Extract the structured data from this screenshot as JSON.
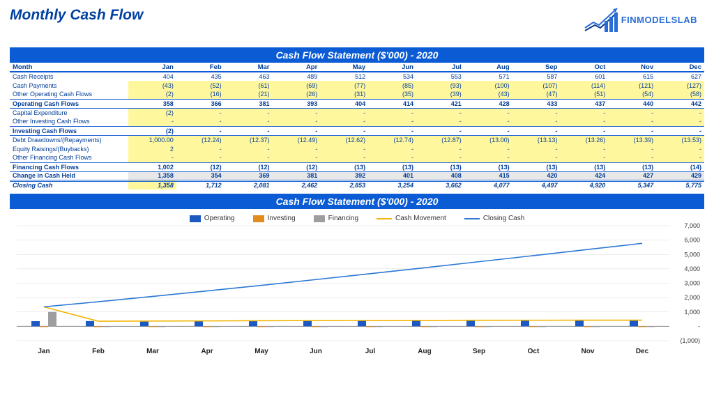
{
  "title": "Monthly Cash Flow",
  "logo_text": "FINMODELSLAB",
  "banner_table": "Cash Flow Statement ($'000) - 2020",
  "banner_chart": "Cash Flow Statement ($'000) - 2020",
  "header_label": "Month",
  "months": [
    "Jan",
    "Feb",
    "Mar",
    "Apr",
    "May",
    "Jun",
    "Jul",
    "Aug",
    "Sep",
    "Oct",
    "Nov",
    "Dec"
  ],
  "rows": {
    "cash_receipts": {
      "label": "Cash Receipts",
      "v": [
        "404",
        "435",
        "463",
        "489",
        "512",
        "534",
        "553",
        "571",
        "587",
        "601",
        "615",
        "627"
      ]
    },
    "cash_payments": {
      "label": "Cash Payments",
      "v": [
        "(43)",
        "(52)",
        "(61)",
        "(69)",
        "(77)",
        "(85)",
        "(93)",
        "(100)",
        "(107)",
        "(114)",
        "(121)",
        "(127)"
      ]
    },
    "other_operating": {
      "label": "Other Operating Cash Flows",
      "v": [
        "(2)",
        "(16)",
        "(21)",
        "(26)",
        "(31)",
        "(35)",
        "(39)",
        "(43)",
        "(47)",
        "(51)",
        "(54)",
        "(58)"
      ]
    },
    "operating_total": {
      "label": "Operating Cash Flows",
      "v": [
        "358",
        "366",
        "381",
        "393",
        "404",
        "414",
        "421",
        "428",
        "433",
        "437",
        "440",
        "442"
      ]
    },
    "capex": {
      "label": "Capital Expenditure",
      "v": [
        "(2)",
        "-",
        "-",
        "-",
        "-",
        "-",
        "-",
        "-",
        "-",
        "-",
        "-",
        "-"
      ]
    },
    "other_investing": {
      "label": "Other Investing Cash Flows",
      "v": [
        "-",
        "-",
        "-",
        "-",
        "-",
        "-",
        "-",
        "-",
        "-",
        "-",
        "-",
        "-"
      ]
    },
    "investing_total": {
      "label": "Investing Cash Flows",
      "v": [
        "(2)",
        "-",
        "-",
        "-",
        "-",
        "-",
        "-",
        "-",
        "-",
        "-",
        "-",
        "-"
      ]
    },
    "debt_drawdowns": {
      "label": "Debt Drawdowns/(Repayments)",
      "v": [
        "1,000.00",
        "(12.24)",
        "(12.37)",
        "(12.49)",
        "(12.62)",
        "(12.74)",
        "(12.87)",
        "(13.00)",
        "(13.13)",
        "(13.26)",
        "(13.39)",
        "(13.53)"
      ]
    },
    "equity_raisings": {
      "label": "Equity Raisings/(Buybacks)",
      "v": [
        "2",
        "-",
        "-",
        "-",
        "-",
        "-",
        "-",
        "-",
        "-",
        "-",
        "-",
        "-"
      ]
    },
    "other_financing": {
      "label": "Other Financing Cash Flows",
      "v": [
        "-",
        "-",
        "-",
        "-",
        "-",
        "-",
        "-",
        "-",
        "-",
        "-",
        "-",
        "-"
      ]
    },
    "financing_total": {
      "label": "Financing Cash Flows",
      "v": [
        "1,002",
        "(12)",
        "(12)",
        "(12)",
        "(13)",
        "(13)",
        "(13)",
        "(13)",
        "(13)",
        "(13)",
        "(13)",
        "(14)"
      ]
    },
    "change_cash": {
      "label": "Change in Cash Held",
      "v": [
        "1,358",
        "354",
        "369",
        "381",
        "392",
        "401",
        "408",
        "415",
        "420",
        "424",
        "427",
        "429"
      ]
    },
    "closing_cash": {
      "label": "Closing Cash",
      "v": [
        "1,358",
        "1,712",
        "2,081",
        "2,462",
        "2,853",
        "3,254",
        "3,662",
        "4,077",
        "4,497",
        "4,920",
        "5,347",
        "5,775"
      ]
    }
  },
  "chart_data": {
    "type": "bar+line",
    "categories": [
      "Jan",
      "Feb",
      "Mar",
      "Apr",
      "May",
      "Jun",
      "Jul",
      "Aug",
      "Sep",
      "Oct",
      "Nov",
      "Dec"
    ],
    "series": [
      {
        "name": "Operating",
        "type": "bar",
        "color": "#1b58c2",
        "values": [
          358,
          366,
          381,
          393,
          404,
          414,
          421,
          428,
          433,
          437,
          440,
          442
        ]
      },
      {
        "name": "Investing",
        "type": "bar",
        "color": "#e28c1d",
        "values": [
          -2,
          0,
          0,
          0,
          0,
          0,
          0,
          0,
          0,
          0,
          0,
          0
        ]
      },
      {
        "name": "Financing",
        "type": "bar",
        "color": "#9e9e9e",
        "values": [
          1002,
          -12,
          -12,
          -12,
          -13,
          -13,
          -13,
          -13,
          -13,
          -13,
          -13,
          -14
        ]
      },
      {
        "name": "Cash Movement",
        "type": "line",
        "color": "#f2b400",
        "values": [
          1358,
          354,
          369,
          381,
          392,
          401,
          408,
          415,
          420,
          424,
          427,
          429
        ]
      },
      {
        "name": "Closing Cash",
        "type": "line",
        "color": "#2a78d4",
        "values": [
          1358,
          1712,
          2081,
          2462,
          2853,
          3254,
          3662,
          4077,
          4497,
          4920,
          5347,
          5775
        ]
      }
    ],
    "ylim": [
      -1000,
      7000
    ],
    "yticks": [
      -1000,
      0,
      1000,
      2000,
      3000,
      4000,
      5000,
      6000,
      7000
    ],
    "ytick_labels": [
      "(1,000)",
      "-",
      "1,000",
      "2,000",
      "3,000",
      "4,000",
      "5,000",
      "6,000",
      "7,000"
    ]
  },
  "legend": [
    "Operating",
    "Investing",
    "Financing",
    "Cash Movement",
    "Closing Cash"
  ]
}
